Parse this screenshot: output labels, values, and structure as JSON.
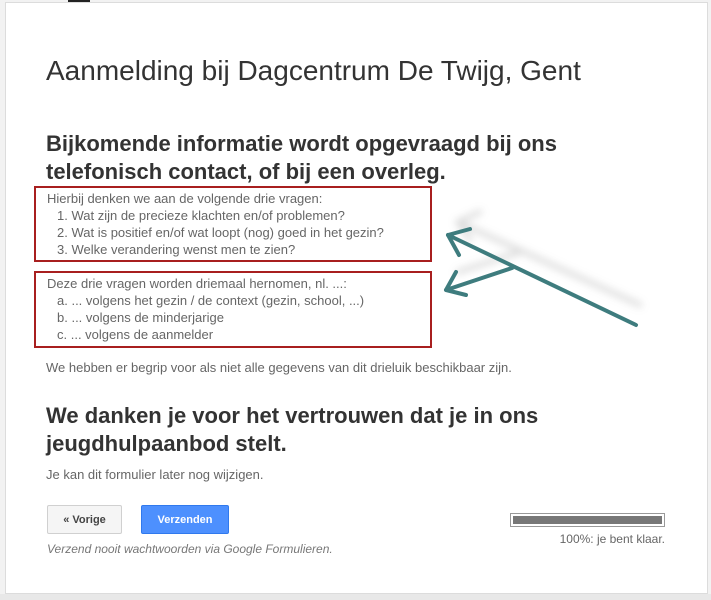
{
  "form": {
    "title": "Aanmelding bij Dagcentrum De Twijg, Gent",
    "section_title": "Bijkomende informatie wordt opgevraagd bij ons telefonisch contact, of bij een overleg.",
    "questions_intro": "Hierbij denken we aan de volgende drie vragen:",
    "questions": [
      "1. Wat zijn de precieze klachten en/of problemen?",
      "2. Wat is positief en/of wat loopt (nog) goed in het gezin?",
      "3. Welke verandering wenst men te zien?"
    ],
    "perspectives_intro": "Deze drie vragen worden driemaal hernomen, nl. ...:",
    "perspectives": [
      "a. ... volgens het gezin / de context (gezin, school, ...)",
      "b. ... volgens de minderjarige",
      "c. ... volgens de aanmelder"
    ],
    "understanding_note": "We hebben er begrip voor als niet alle gegevens van dit drieluik beschikbaar zijn.",
    "thanks": "We danken je voor het vertrouwen dat je in ons jeugdhulpaanbod stelt.",
    "edit_note": "Je kan dit formulier later nog wijzigen."
  },
  "buttons": {
    "back_label": "« Vorige",
    "submit_label": "Verzenden"
  },
  "footer": {
    "warning": "Verzend nooit wachtwoorden via Google Formulieren."
  },
  "progress": {
    "value": 1.0,
    "label": "100%: je bent klaar."
  },
  "colors": {
    "highlight_border": "#a81f1f",
    "arrow": "#3e7c7e",
    "submit_button": "#4d90fe"
  }
}
